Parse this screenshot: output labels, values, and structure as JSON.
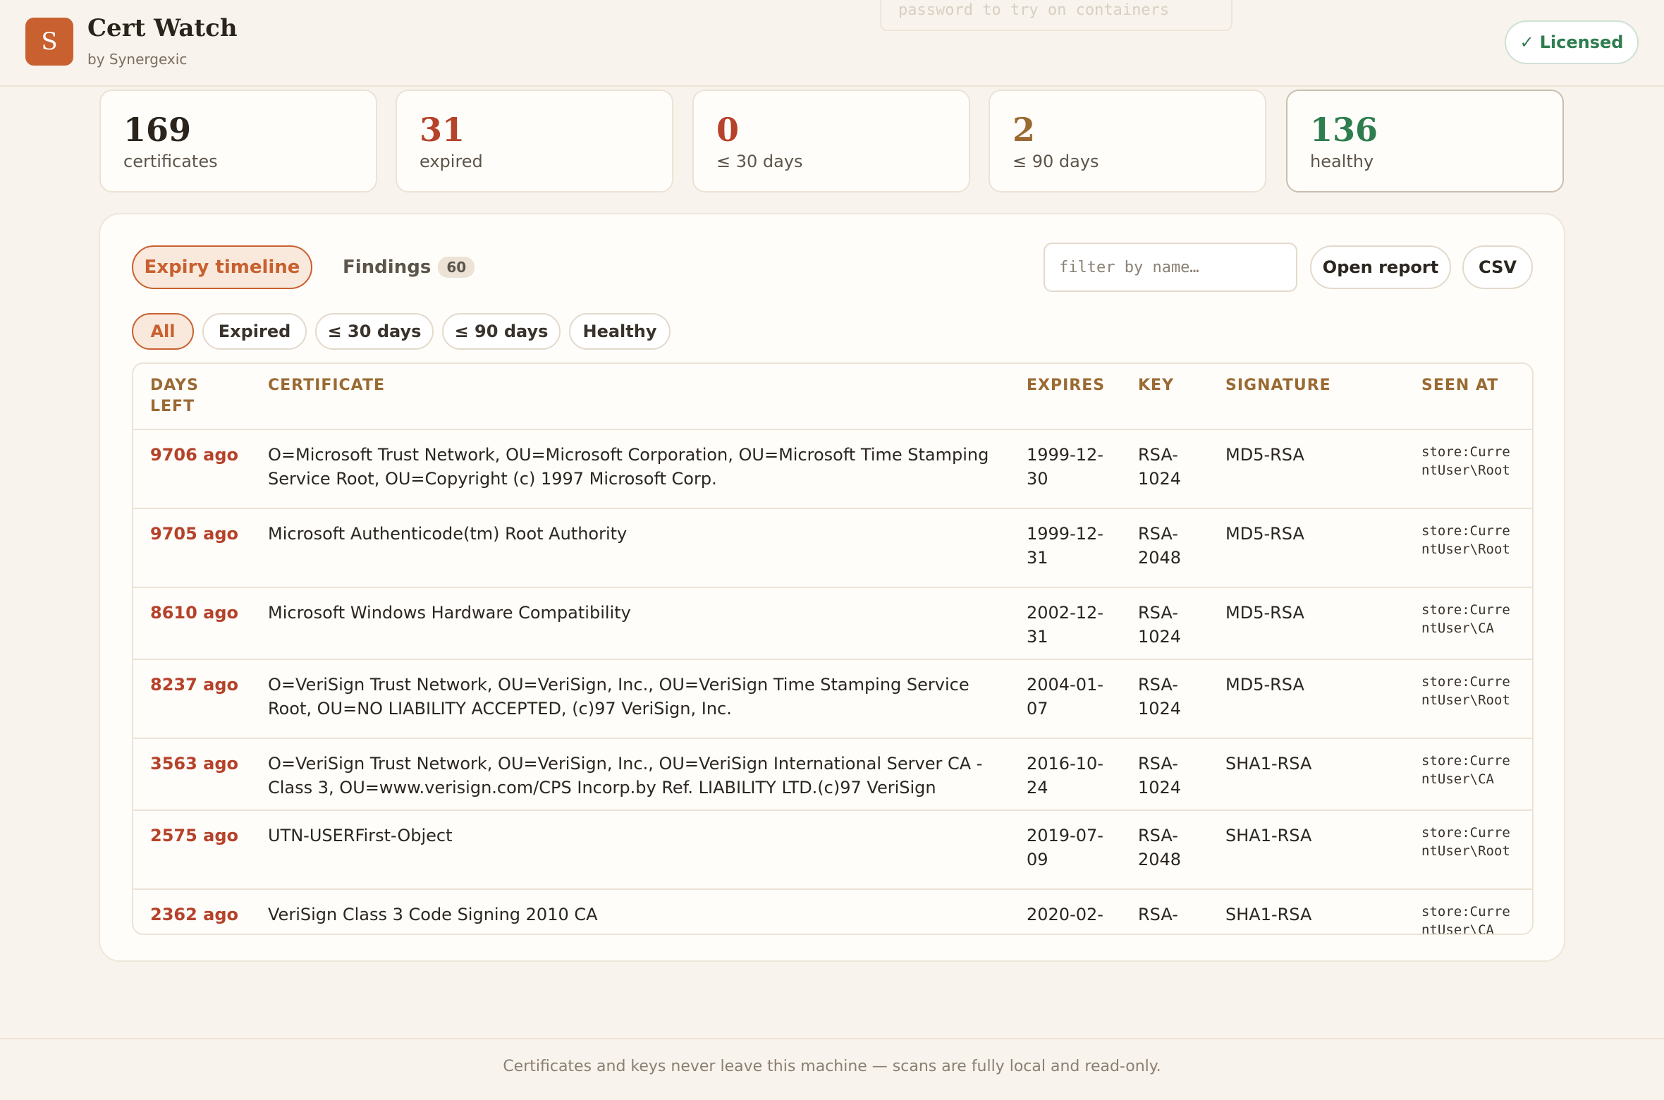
{
  "app": {
    "logo_letter": "S",
    "title": "Cert Watch",
    "subtitle": "by Synergexic",
    "bg_input_text": "password to try on containers",
    "license_check": "✓",
    "license_label": "Licensed"
  },
  "stats": [
    {
      "value": "169",
      "label": "certificates",
      "color": "#2a241d"
    },
    {
      "value": "31",
      "label": "expired",
      "color": "#b5422a"
    },
    {
      "value": "0",
      "label": "≤ 30 days",
      "color": "#b5422a"
    },
    {
      "value": "2",
      "label": "≤ 90 days",
      "color": "#9a6a33"
    },
    {
      "value": "136",
      "label": "healthy",
      "color": "#2e7d4f"
    }
  ],
  "tabs": {
    "timeline": "Expiry timeline",
    "findings": "Findings",
    "findings_count": "60"
  },
  "toolbar": {
    "filter_placeholder": "filter by name…",
    "open_report": "Open report",
    "csv": "CSV"
  },
  "filters": [
    "All",
    "Expired",
    "≤ 30 days",
    "≤ 90 days",
    "Healthy"
  ],
  "table": {
    "headers": {
      "days_left": "DAYS LEFT",
      "certificate": "CERTIFICATE",
      "expires": "EXPIRES",
      "key": "KEY",
      "signature": "SIGNATURE",
      "seen_at": "SEEN AT"
    },
    "rows": [
      {
        "days": "9706 ago",
        "certificate": "O=Microsoft Trust Network, OU=Microsoft Corporation, OU=Microsoft Time Stamping Service Root, OU=Copyright (c) 1997 Microsoft Corp.",
        "expires": "1999-12-30",
        "key": "RSA-1024",
        "signature": "MD5-RSA",
        "seen_at": "store:CurrentUser\\Root"
      },
      {
        "days": "9705 ago",
        "certificate": "Microsoft Authenticode(tm) Root Authority",
        "expires": "1999-12-31",
        "key": "RSA-2048",
        "signature": "MD5-RSA",
        "seen_at": "store:CurrentUser\\Root"
      },
      {
        "days": "8610 ago",
        "certificate": "Microsoft Windows Hardware Compatibility",
        "expires": "2002-12-31",
        "key": "RSA-1024",
        "signature": "MD5-RSA",
        "seen_at": "store:CurrentUser\\CA"
      },
      {
        "days": "8237 ago",
        "certificate": "O=VeriSign Trust Network, OU=VeriSign, Inc., OU=VeriSign Time Stamping Service Root, OU=NO LIABILITY ACCEPTED, (c)97 VeriSign, Inc.",
        "expires": "2004-01-07",
        "key": "RSA-1024",
        "signature": "MD5-RSA",
        "seen_at": "store:CurrentUser\\Root"
      },
      {
        "days": "3563 ago",
        "certificate": "O=VeriSign Trust Network, OU=VeriSign, Inc., OU=VeriSign International Server CA - Class 3, OU=www.verisign.com/CPS Incorp.by Ref. LIABILITY LTD.(c)97 VeriSign",
        "expires": "2016-10-24",
        "key": "RSA-1024",
        "signature": "SHA1-RSA",
        "seen_at": "store:CurrentUser\\CA"
      },
      {
        "days": "2575 ago",
        "certificate": "UTN-USERFirst-Object",
        "expires": "2019-07-09",
        "key": "RSA-2048",
        "signature": "SHA1-RSA",
        "seen_at": "store:CurrentUser\\Root"
      },
      {
        "days": "2362 ago",
        "certificate": "VeriSign Class 3 Code Signing 2010 CA",
        "expires": "2020-02-",
        "key": "RSA-",
        "signature": "SHA1-RSA",
        "seen_at": "store:CurrentUser\\CA"
      }
    ]
  },
  "footer": "Certificates and keys never leave this machine — scans are fully local and read-only."
}
